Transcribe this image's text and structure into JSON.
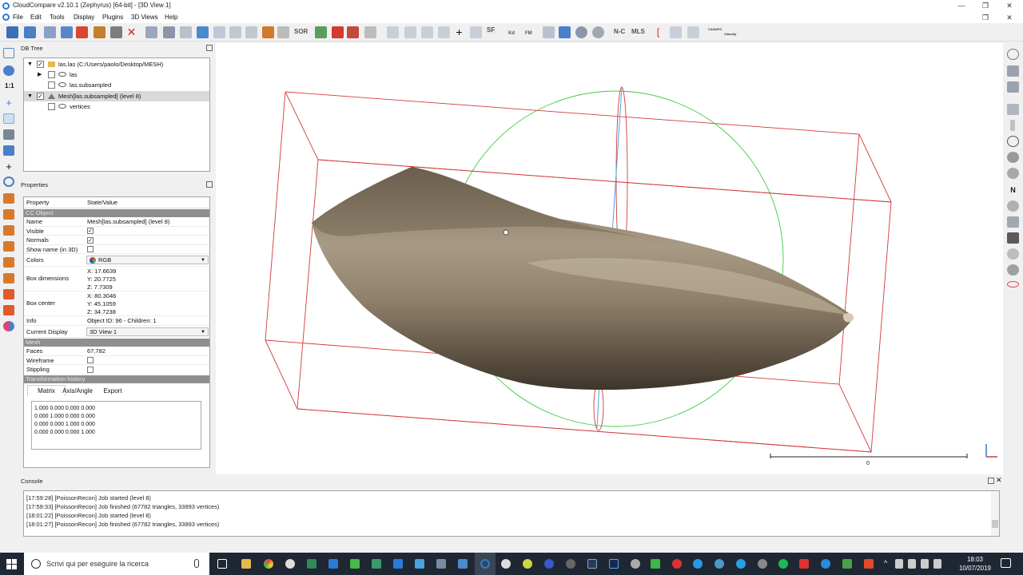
{
  "window": {
    "title": "CloudCompare v2.10.1 (Zephyrus) [64-bit] - [3D View 1]",
    "minimize": "—",
    "restore": "❐",
    "close": "✕"
  },
  "menu": [
    "File",
    "Edit",
    "Tools",
    "Display",
    "Plugins",
    "3D Views",
    "Help"
  ],
  "toolbar": {
    "sor": "SOR",
    "sf": "SF",
    "kd": "Kd",
    "fm": "FM",
    "nc": "N-C",
    "mls": "MLS",
    "canupo": "CANUPO",
    "classify": "Classify"
  },
  "left_toolbar": {
    "zoom_ratio": "1:1"
  },
  "db_tree": {
    "header": "DB Tree",
    "items": [
      {
        "label": "las.las (C:/Users/paolo/Desktop/MESH)",
        "checked": true,
        "expanded": true,
        "icon": "folder-icon"
      },
      {
        "label": "las",
        "checked": false,
        "icon": "cloud-icon"
      },
      {
        "label": "las.subsampled",
        "checked": false,
        "icon": "cloud-icon"
      },
      {
        "label": "Mesh[las.subsampled] (level 8)",
        "checked": true,
        "expanded": true,
        "icon": "mesh-icon",
        "selected": true
      },
      {
        "label": "vertices",
        "checked": false,
        "icon": "cloud-icon"
      }
    ]
  },
  "properties": {
    "header": "Properties",
    "col_property": "Property",
    "col_value": "State/Value",
    "section_ccobject": "CC Object",
    "name_key": "Name",
    "name_val": "Mesh[las.subsampled] (level 8)",
    "visible_key": "Visible",
    "normals_key": "Normals",
    "showname_key": "Show name (in 3D)",
    "colors_key": "Colors",
    "colors_val": "RGB",
    "boxdim_key": "Box dimensions",
    "boxdim_x": "X: 17.6639",
    "boxdim_y": "Y: 20.7725",
    "boxdim_z": "Z: 7.7309",
    "boxcenter_key": "Box center",
    "boxcenter_x": "X: 80.3046",
    "boxcenter_y": "Y: 45.1059",
    "boxcenter_z": "Z: 34.7238",
    "info_key": "Info",
    "info_val": "Object ID: 96 - Children: 1",
    "display_key": "Current Display",
    "display_val": "3D View 1",
    "section_mesh": "Mesh",
    "faces_key": "Faces",
    "faces_val": "67,782",
    "wireframe_key": "Wireframe",
    "stippling_key": "Stippling",
    "section_transform": "Transformation history",
    "tabs": [
      "Matrix",
      "Axis/Angle",
      "Export"
    ],
    "matrix": [
      "1.000 0.000 0.000 0.000",
      "0.000 1.000 0.000 0.000",
      "0.000 0.000 1.000 0.000",
      "0.000 0.000 0.000 1.000"
    ]
  },
  "viewport": {
    "scale_label": "0"
  },
  "console": {
    "header": "Console",
    "lines": [
      "[17:59:28] [PoissonRecon] Job started (level 8)",
      "[17:59:33] [PoissonRecon] Job finished (67782 triangles, 33893 vertices)",
      "[18:01:22] [PoissonRecon] Job started (level 8)",
      "[18:01:27] [PoissonRecon] Job finished (67782 triangles, 33893 vertices)"
    ]
  },
  "taskbar": {
    "search_placeholder": "Scrivi qui per eseguire la ricerca",
    "time": "18:03",
    "date": "10/07/2019"
  },
  "colors": {
    "bbox": "#d33a3a",
    "sphere": "#3ccc3c",
    "mesh": "#8a7b66",
    "accent": "#2a7bd6"
  }
}
